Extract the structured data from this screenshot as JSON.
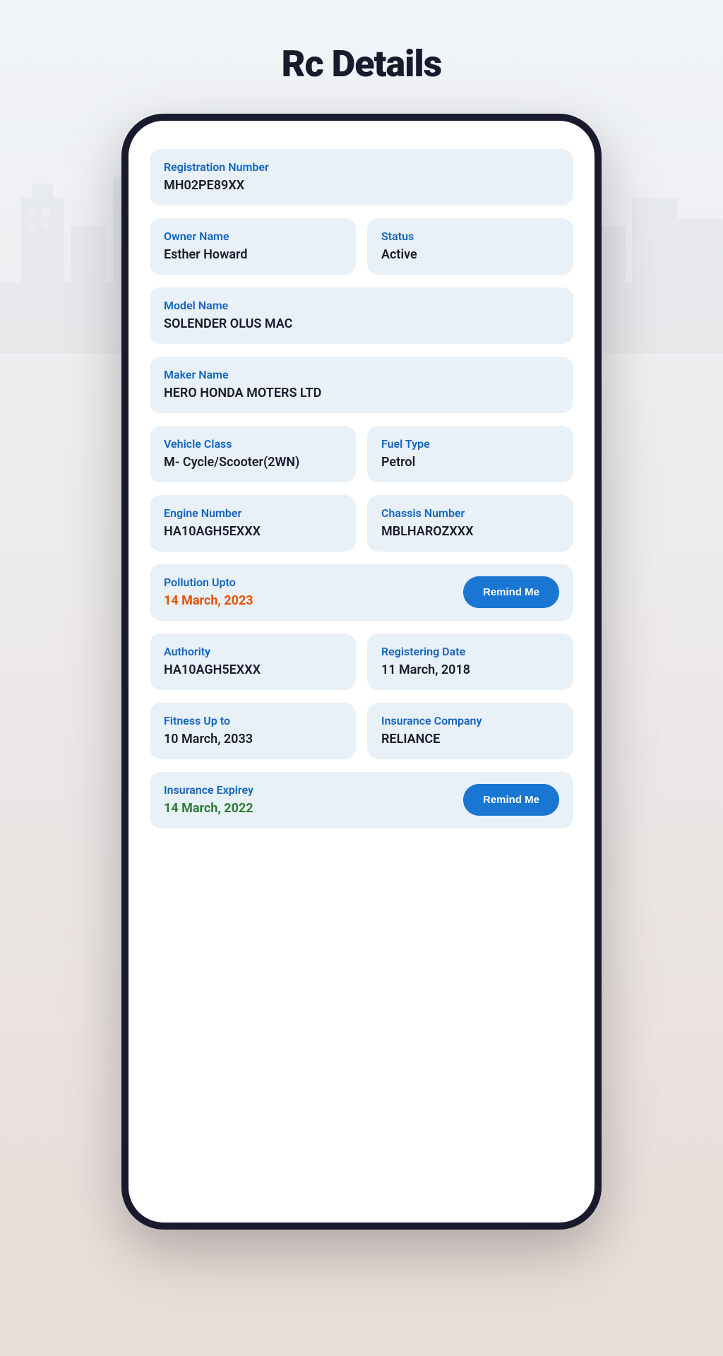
{
  "page": {
    "title": "Rc Details"
  },
  "fields": {
    "registration_number": {
      "label": "Registration Number",
      "value": "MH02PE89XX"
    },
    "owner_name": {
      "label": "Owner  Name",
      "value": "Esther Howard"
    },
    "status": {
      "label": "Status",
      "value": "Active"
    },
    "model_name": {
      "label": "Model Name",
      "value": "SOLENDER OLUS MAC"
    },
    "maker_name": {
      "label": "Maker Name",
      "value": "HERO HONDA MOTERS LTD"
    },
    "vehicle_class": {
      "label": "Vehicle Class",
      "value": "M- Cycle/Scooter(2WN)"
    },
    "fuel_type": {
      "label": "Fuel Type",
      "value": "Petrol"
    },
    "engine_number": {
      "label": "Engine Number",
      "value": "HA10AGH5EXXX"
    },
    "chassis_number": {
      "label": "Chassis Number",
      "value": "MBLHAROZXXX"
    },
    "pollution_upto": {
      "label": "Pollution Upto",
      "value": "14 March, 2023",
      "color": "orange"
    },
    "authority": {
      "label": "Authority",
      "value": "HA10AGH5EXXX"
    },
    "registering_date": {
      "label": "Registering Date",
      "value": "11 March, 2018"
    },
    "fitness_upto": {
      "label": "Fitness Up to",
      "value": "10 March, 2033"
    },
    "insurance_company": {
      "label": "Insurance Company",
      "value": "RELIANCE"
    },
    "insurance_expirey": {
      "label": "Insurance Expirey",
      "value": "14 March, 2022",
      "color": "green"
    }
  },
  "buttons": {
    "remind_me": "Remind Me"
  }
}
